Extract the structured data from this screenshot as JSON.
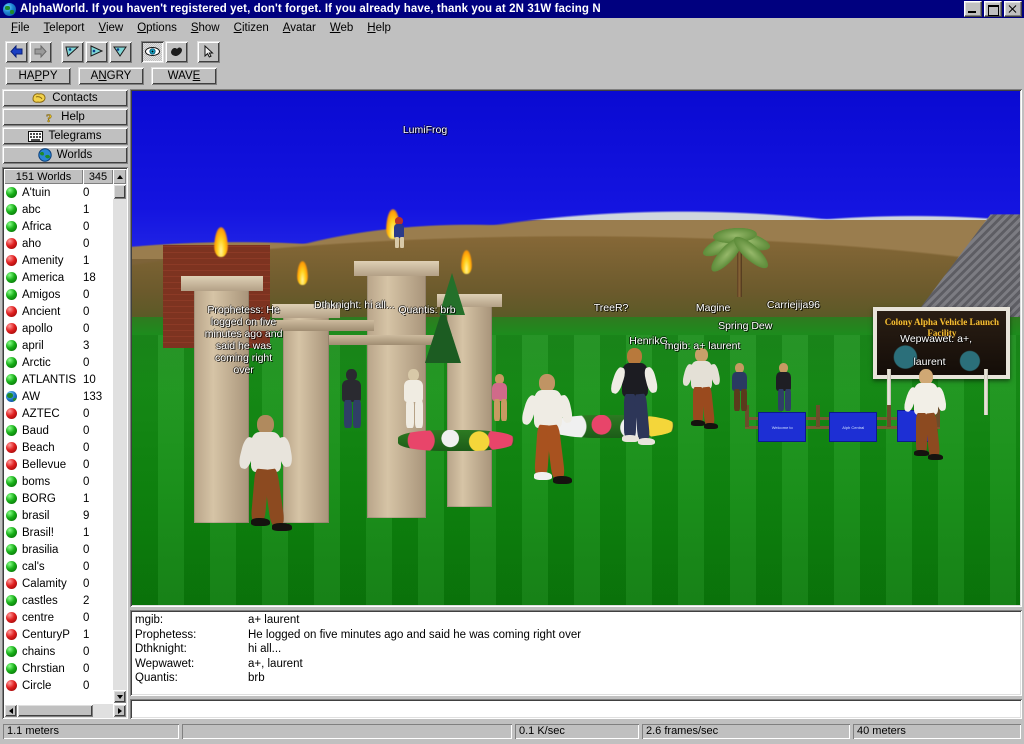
{
  "window": {
    "title": "AlphaWorld.  If you haven't registered yet, don't forget.   If you already have, thank you at 2N 31W facing N",
    "icon": "globe-icon",
    "minimize_label": "Minimize",
    "maximize_label": "Maximize",
    "close_label": "Close"
  },
  "menu": {
    "items": [
      {
        "label": "File",
        "accel": "F"
      },
      {
        "label": "Teleport",
        "accel": "T"
      },
      {
        "label": "View",
        "accel": "V"
      },
      {
        "label": "Options",
        "accel": "O"
      },
      {
        "label": "Show",
        "accel": "S"
      },
      {
        "label": "Citizen",
        "accel": "C"
      },
      {
        "label": "Avatar",
        "accel": "A"
      },
      {
        "label": "Web",
        "accel": "W"
      },
      {
        "label": "Help",
        "accel": "H"
      }
    ]
  },
  "toolbar": {
    "buttons": [
      {
        "name": "back-button",
        "icon": "left-arrow-icon",
        "pressed": false
      },
      {
        "name": "forward-button",
        "icon": "right-arrow-icon",
        "pressed": false
      },
      {
        "name": "teleport-1-button",
        "icon": "triangle-left-icon",
        "pressed": false
      },
      {
        "name": "teleport-2-button",
        "icon": "triangle-right-icon",
        "pressed": false
      },
      {
        "name": "teleport-3-button",
        "icon": "triangle-down-icon",
        "pressed": false
      },
      {
        "name": "view-eye-button",
        "icon": "eye-icon",
        "pressed": true
      },
      {
        "name": "avatar-button",
        "icon": "bird-icon",
        "pressed": false
      },
      {
        "name": "select-button",
        "icon": "cursor-arrow-icon",
        "pressed": false
      }
    ]
  },
  "gestures": {
    "buttons": [
      {
        "label": "HAPPY",
        "accel": "P"
      },
      {
        "label": "ANGRY",
        "accel": "N"
      },
      {
        "label": "WAVE",
        "accel": "E"
      }
    ]
  },
  "sidebar": {
    "buttons": [
      {
        "label": "Contacts",
        "icon": "contacts-icon"
      },
      {
        "label": "Help",
        "icon": "question-mark-icon"
      },
      {
        "label": "Telegrams",
        "icon": "telegram-icon"
      },
      {
        "label": "Worlds",
        "icon": "globe-icon"
      }
    ],
    "list_header": {
      "name_col": "151 Worlds",
      "count_col": "345"
    },
    "worlds": [
      {
        "name": "A'tuin",
        "count": "0",
        "status": "green"
      },
      {
        "name": "abc",
        "count": "1",
        "status": "green"
      },
      {
        "name": "Africa",
        "count": "0",
        "status": "green"
      },
      {
        "name": "aho",
        "count": "0",
        "status": "red"
      },
      {
        "name": "Amenity",
        "count": "1",
        "status": "red"
      },
      {
        "name": "America",
        "count": "18",
        "status": "green"
      },
      {
        "name": "Amigos",
        "count": "0",
        "status": "green"
      },
      {
        "name": "Ancient",
        "count": "0",
        "status": "red"
      },
      {
        "name": "apollo",
        "count": "0",
        "status": "red"
      },
      {
        "name": "april",
        "count": "3",
        "status": "green"
      },
      {
        "name": "Arctic",
        "count": "0",
        "status": "green"
      },
      {
        "name": "ATLANTIS",
        "count": "10",
        "status": "green"
      },
      {
        "name": "AW",
        "count": "133",
        "status": "globe"
      },
      {
        "name": "AZTEC",
        "count": "0",
        "status": "red"
      },
      {
        "name": "Baud",
        "count": "0",
        "status": "green"
      },
      {
        "name": "Beach",
        "count": "0",
        "status": "red"
      },
      {
        "name": "Bellevue",
        "count": "0",
        "status": "red"
      },
      {
        "name": "boms",
        "count": "0",
        "status": "green"
      },
      {
        "name": "BORG",
        "count": "1",
        "status": "green"
      },
      {
        "name": "brasil",
        "count": "9",
        "status": "green"
      },
      {
        "name": "Brasil!",
        "count": "1",
        "status": "green"
      },
      {
        "name": "brasilia",
        "count": "0",
        "status": "green"
      },
      {
        "name": "cal's",
        "count": "0",
        "status": "green"
      },
      {
        "name": "Calamity",
        "count": "0",
        "status": "red"
      },
      {
        "name": "castles",
        "count": "2",
        "status": "green"
      },
      {
        "name": "centre",
        "count": "0",
        "status": "red"
      },
      {
        "name": "CenturyP",
        "count": "1",
        "status": "red"
      },
      {
        "name": "chains",
        "count": "0",
        "status": "green"
      },
      {
        "name": "Chrstian",
        "count": "0",
        "status": "green"
      },
      {
        "name": "Circle",
        "count": "0",
        "status": "red"
      }
    ]
  },
  "scene": {
    "overlay_labels": [
      {
        "id": "lumifrog",
        "text": "LumiFrog"
      },
      {
        "id": "prophetess",
        "text": "Prophetess: He\nlogged on five\nminutes ago and\nsaid he was\ncoming right\nover"
      },
      {
        "id": "dthknight",
        "text": "Dthknight: hi all..."
      },
      {
        "id": "quantis",
        "text": "Quantis: brb"
      },
      {
        "id": "treer",
        "text": "TreeR?"
      },
      {
        "id": "henrikg",
        "text": "HenrikG"
      },
      {
        "id": "magine",
        "text": "Magine"
      },
      {
        "id": "carriejija96",
        "text": "Carriejija96"
      },
      {
        "id": "springdew",
        "text": "Spring Dew"
      },
      {
        "id": "mgib",
        "text": "mgib: a+ laurent"
      },
      {
        "id": "wepwawet",
        "text": "Wepwawet: a+,"
      },
      {
        "id": "laurent",
        "text": "laurent"
      }
    ],
    "billboard_text": "Colony Alpha\nVehicle Launch\nFacility",
    "signs": [
      {
        "text": "Welcome to"
      },
      {
        "text": "Alph Central"
      }
    ],
    "sky_color": "#0d0dd4",
    "ground_color": "#179217",
    "mountain_color": "#8a7046"
  },
  "chat": {
    "messages": [
      {
        "who": "mgib:",
        "text": "a+ laurent"
      },
      {
        "who": "Prophetess:",
        "text": "He logged on five minutes ago and said he was coming right over"
      },
      {
        "who": "Dthknight:",
        "text": "hi all..."
      },
      {
        "who": "Wepwawet:",
        "text": "a+, laurent"
      },
      {
        "who": "Quantis:",
        "text": "brb"
      }
    ],
    "input_value": "",
    "input_placeholder": ""
  },
  "statusbar": {
    "panes": [
      {
        "name": "height-pane",
        "text": "1.1 meters"
      },
      {
        "name": "message-pane",
        "text": ""
      },
      {
        "name": "bandwidth-pane",
        "text": "0.1 K/sec"
      },
      {
        "name": "fps-pane",
        "text": "2.6 frames/sec"
      },
      {
        "name": "visibility-pane",
        "text": "40 meters"
      }
    ]
  }
}
